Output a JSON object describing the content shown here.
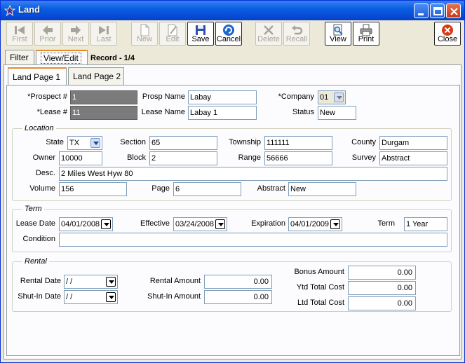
{
  "window": {
    "title": "Land"
  },
  "toolbar": {
    "first": "First",
    "prior": "Prior",
    "next": "Next",
    "last": "Last",
    "new": "New",
    "edit": "Edit",
    "save": "Save",
    "cancel": "Cancel",
    "delete": "Delete",
    "recall": "Recall",
    "view": "View",
    "print": "Print",
    "close": "Close"
  },
  "tabs": {
    "filter": "Filter",
    "view_edit": "View/Edit",
    "record": "Record - 1/4"
  },
  "subtabs": {
    "page1": "Land Page 1",
    "page2": "Land Page 2"
  },
  "header": {
    "prospect_label": "*Prospect #",
    "prospect_value": "1",
    "lease_label": "*Lease #",
    "lease_value": "11",
    "prosp_name_label": "Prosp Name",
    "prosp_name_value": "Labay",
    "lease_name_label": "Lease Name",
    "lease_name_value": "Labay 1",
    "company_label": "*Company",
    "company_value": "01",
    "status_label": "Status",
    "status_value": "New"
  },
  "location": {
    "title": "Location",
    "state_label": "State",
    "state_value": "TX",
    "section_label": "Section",
    "section_value": "65",
    "township_label": "Township",
    "township_value": "111111",
    "county_label": "County",
    "county_value": "Durgam",
    "owner_label": "Owner",
    "owner_value": "10000",
    "block_label": "Block",
    "block_value": "2",
    "range_label": "Range",
    "range_value": "56666",
    "survey_label": "Survey",
    "survey_value": "Abstract",
    "desc_label": "Desc.",
    "desc_value": "2 Miles West Hyw 80",
    "volume_label": "Volume",
    "volume_value": "156",
    "page_label": "Page",
    "page_value": "6",
    "abstract_label": "Abstract",
    "abstract_value": "New"
  },
  "term": {
    "title": "Term",
    "lease_date_label": "Lease Date",
    "lease_date_value": "04/01/2008",
    "effective_label": "Effective",
    "effective_value": "03/24/2008",
    "expiration_label": "Expiration",
    "expiration_value": "04/01/2009",
    "term_label": "Term",
    "term_value": "1 Year",
    "condition_label": "Condition",
    "condition_value": ""
  },
  "rental": {
    "title": "Rental",
    "rental_date_label": "Rental Date",
    "rental_date_value": " /  /",
    "shutin_date_label": "Shut-In Date",
    "shutin_date_value": " /  /",
    "rental_amount_label": "Rental Amount",
    "rental_amount_value": "0.00",
    "shutin_amount_label": "Shut-In Amount",
    "shutin_amount_value": "0.00",
    "bonus_label": "Bonus Amount",
    "bonus_value": "0.00",
    "ytd_label": "Ytd Total Cost",
    "ytd_value": "0.00",
    "ltd_label": "Ltd Total Cost",
    "ltd_value": "0.00"
  }
}
